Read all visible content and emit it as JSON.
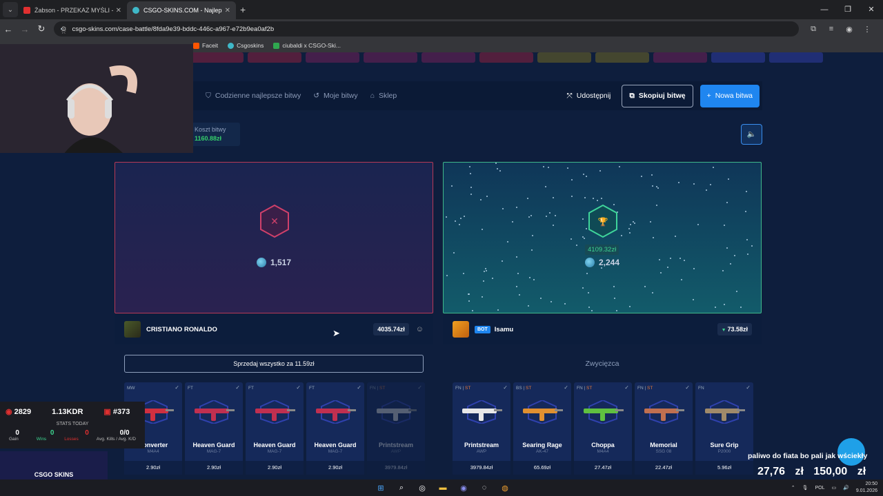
{
  "browser": {
    "tabs": [
      {
        "title": "Żabson - PRZEKAZ MYŚLI - You",
        "color": "#e03030"
      },
      {
        "title": "CSGO-SKINS.COM - Najlepsze",
        "color": "#3fb8c8"
      }
    ],
    "url": "csgo-skins.com/case-battle/8fda9e39-bddc-446c-a967-e72b9ea0af2b",
    "bookmarks": [
      "Faceit",
      "Csgoskins",
      "ciubaldi x CSGO-Ski..."
    ]
  },
  "subnav": {
    "daily": "Codzienne najlepsze bitwy",
    "my_battles": "Moje bitwy",
    "shop": "Sklep",
    "share": "Udostępnij",
    "copy": "Skopiuj bitwę",
    "new": "Nowa bitwa"
  },
  "cost": {
    "label": "Koszt bitwy",
    "value": "1160.88zł"
  },
  "left": {
    "amount": "1,517",
    "player": "CRISTIANO RONALDO",
    "total": "4035.74zł",
    "sell": "Sprzedaj wszystko za 11.59zł",
    "items": [
      {
        "cond": "MW",
        "st": "",
        "name": "Converter",
        "weapon": "M4A4",
        "price": "2.90zł",
        "color": "#d03040",
        "dim": false
      },
      {
        "cond": "FT",
        "st": "",
        "name": "Heaven Guard",
        "weapon": "MAG-7",
        "price": "2.90zł",
        "color": "#c03050",
        "dim": false
      },
      {
        "cond": "FT",
        "st": "",
        "name": "Heaven Guard",
        "weapon": "MAG-7",
        "price": "2.90zł",
        "color": "#c03050",
        "dim": false
      },
      {
        "cond": "FT",
        "st": "",
        "name": "Heaven Guard",
        "weapon": "MAG-7",
        "price": "2.90zł",
        "color": "#c03050",
        "dim": false
      },
      {
        "cond": "FN",
        "st": "ST",
        "name": "Printstream",
        "weapon": "AWP",
        "price": "3979.84zł",
        "color": "#d8d8d8",
        "dim": true
      }
    ]
  },
  "right": {
    "win_price": "4109.32zł",
    "amount": "2,244",
    "bot_label": "BOT",
    "player": "Isamu",
    "total": "73.58zł",
    "winner": "Zwycięzca",
    "items": [
      {
        "cond": "FN",
        "st": "ST",
        "name": "Printstream",
        "weapon": "AWP",
        "price": "3979.84zł",
        "color": "#e8e8e8"
      },
      {
        "cond": "BS",
        "st": "ST",
        "name": "Searing Rage",
        "weapon": "AK-47",
        "price": "65.69zł",
        "color": "#e09030"
      },
      {
        "cond": "FN",
        "st": "ST",
        "name": "Choppa",
        "weapon": "M4A4",
        "price": "27.47zł",
        "color": "#60c040"
      },
      {
        "cond": "FN",
        "st": "ST",
        "name": "Memorial",
        "weapon": "SSG 08",
        "price": "22.47zł",
        "color": "#c07050"
      },
      {
        "cond": "FN",
        "st": "",
        "name": "Sure Grip",
        "weapon": "P2000",
        "price": "5.96zł",
        "color": "#a08a6a"
      }
    ]
  },
  "stream": {
    "elo": "2829",
    "kdr": "1.13KDR",
    "rank": "#373",
    "stats_label": "STATS TODAY",
    "gain": "0",
    "wins": "0",
    "losses": "0",
    "kd": "0/0",
    "gain_l": "Gain",
    "wins_l": "Wins",
    "losses_l": "Losses",
    "kd_l": "Avg. Kills / Avg. K/D",
    "logo": "CSGO SKINS",
    "donation_msg": "paliwo do fiata bo pali jak wściekły",
    "donation_amt": "27,76 zł 150,00 zł"
  },
  "taskbar": {
    "lang": "POL",
    "time": "20:50",
    "date": "9.01.2026"
  }
}
